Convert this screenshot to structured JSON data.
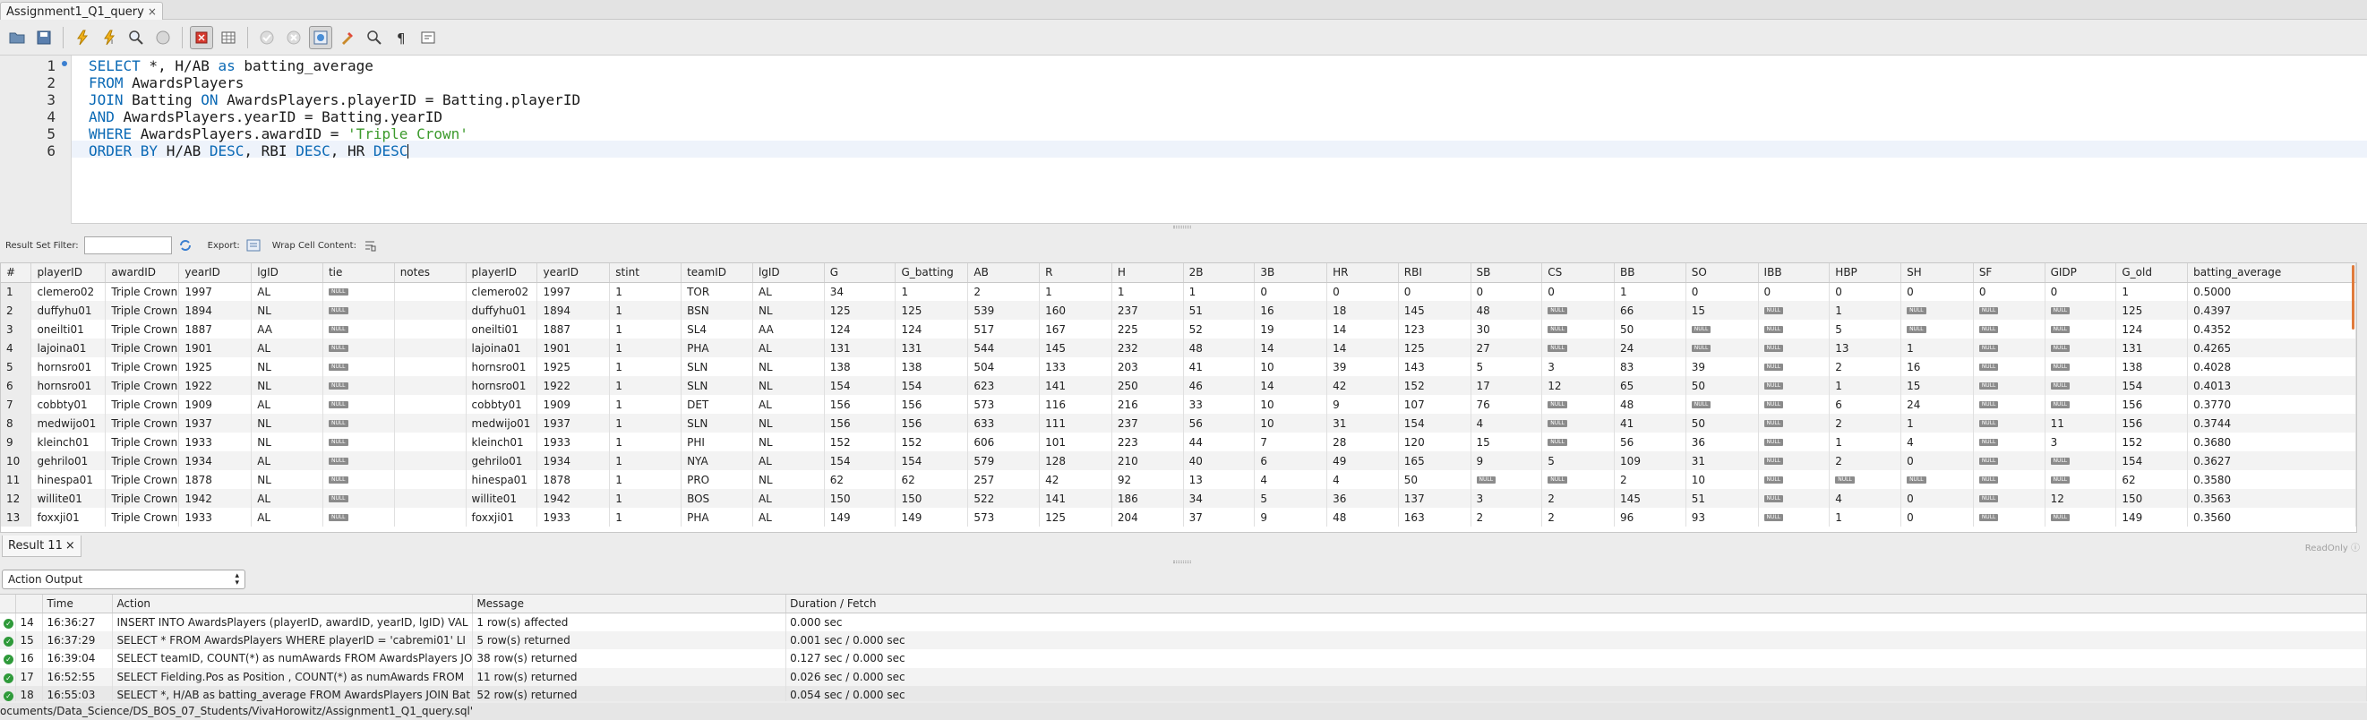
{
  "tab": {
    "title": "Assignment1_Q1_query",
    "close": "×"
  },
  "toolbar": {
    "icons": [
      "folder-open-icon",
      "save-icon",
      "execute-icon",
      "execute-current-icon",
      "explain-icon",
      "stop-icon",
      "stop-on-error-icon",
      "result-toggle-icon",
      "commit-icon",
      "rollback-icon",
      "autocommit-icon",
      "beautify-icon",
      "find-icon",
      "invisible-chars-icon",
      "wrap-icon"
    ]
  },
  "editor": {
    "lines": [
      {
        "num": "1"
      },
      {
        "num": "2"
      },
      {
        "num": "3"
      },
      {
        "num": "4"
      },
      {
        "num": "5"
      },
      {
        "num": "6"
      }
    ],
    "line1": {
      "kw1": "SELECT",
      "t1": " *, H/AB ",
      "kw2": "as",
      "t2": " batting_average"
    },
    "line2": {
      "kw1": "FROM",
      "t1": " AwardsPlayers"
    },
    "line3": {
      "kw1": "JOIN",
      "t1": " Batting ",
      "kw2": "ON",
      "t2": " AwardsPlayers.playerID = Batting.playerID"
    },
    "line4": {
      "kw1": "AND",
      "t1": " AwardsPlayers.yearID = Batting.yearID"
    },
    "line5": {
      "kw1": "WHERE",
      "t1": " AwardsPlayers.awardID = ",
      "str": "'Triple Crown'"
    },
    "line6": {
      "kw1": "ORDER BY",
      "t1": " H/AB ",
      "kw2": "DESC",
      "t2": ", RBI ",
      "kw3": "DESC",
      "t3": ", HR ",
      "kw4": "DESC"
    }
  },
  "filter": {
    "label": "Result Set Filter:",
    "export_label": "Export:",
    "wrap_label": "Wrap Cell Content:"
  },
  "grid": {
    "columns": [
      "#",
      "playerID",
      "awardID",
      "yearID",
      "lgID",
      "tie",
      "notes",
      "playerID",
      "yearID",
      "stint",
      "teamID",
      "lgID",
      "G",
      "G_batting",
      "AB",
      "R",
      "H",
      "2B",
      "3B",
      "HR",
      "RBI",
      "SB",
      "CS",
      "BB",
      "SO",
      "IBB",
      "HBP",
      "SH",
      "SF",
      "GIDP",
      "G_old",
      "batting_average"
    ],
    "null_label": "NULL",
    "rows": [
      [
        "1",
        "clemero02",
        "Triple Crown",
        "1997",
        "AL",
        "NULL",
        "",
        "clemero02",
        "1997",
        "1",
        "TOR",
        "AL",
        "34",
        "1",
        "2",
        "1",
        "1",
        "1",
        "0",
        "0",
        "0",
        "0",
        "0",
        "1",
        "0",
        "0",
        "0",
        "0",
        "0",
        "0",
        "1",
        "0.5000"
      ],
      [
        "2",
        "duffyhu01",
        "Triple Crown",
        "1894",
        "NL",
        "NULL",
        "",
        "duffyhu01",
        "1894",
        "1",
        "BSN",
        "NL",
        "125",
        "125",
        "539",
        "160",
        "237",
        "51",
        "16",
        "18",
        "145",
        "48",
        "NULL",
        "66",
        "15",
        "NULL",
        "1",
        "NULL",
        "NULL",
        "NULL",
        "125",
        "0.4397"
      ],
      [
        "3",
        "oneilti01",
        "Triple Crown",
        "1887",
        "AA",
        "NULL",
        "",
        "oneilti01",
        "1887",
        "1",
        "SL4",
        "AA",
        "124",
        "124",
        "517",
        "167",
        "225",
        "52",
        "19",
        "14",
        "123",
        "30",
        "NULL",
        "50",
        "NULL",
        "NULL",
        "5",
        "NULL",
        "NULL",
        "NULL",
        "124",
        "0.4352"
      ],
      [
        "4",
        "lajoina01",
        "Triple Crown",
        "1901",
        "AL",
        "NULL",
        "",
        "lajoina01",
        "1901",
        "1",
        "PHA",
        "AL",
        "131",
        "131",
        "544",
        "145",
        "232",
        "48",
        "14",
        "14",
        "125",
        "27",
        "NULL",
        "24",
        "NULL",
        "NULL",
        "13",
        "1",
        "NULL",
        "NULL",
        "131",
        "0.4265"
      ],
      [
        "5",
        "hornsro01",
        "Triple Crown",
        "1925",
        "NL",
        "NULL",
        "",
        "hornsro01",
        "1925",
        "1",
        "SLN",
        "NL",
        "138",
        "138",
        "504",
        "133",
        "203",
        "41",
        "10",
        "39",
        "143",
        "5",
        "3",
        "83",
        "39",
        "NULL",
        "2",
        "16",
        "NULL",
        "NULL",
        "138",
        "0.4028"
      ],
      [
        "6",
        "hornsro01",
        "Triple Crown",
        "1922",
        "NL",
        "NULL",
        "",
        "hornsro01",
        "1922",
        "1",
        "SLN",
        "NL",
        "154",
        "154",
        "623",
        "141",
        "250",
        "46",
        "14",
        "42",
        "152",
        "17",
        "12",
        "65",
        "50",
        "NULL",
        "1",
        "15",
        "NULL",
        "NULL",
        "154",
        "0.4013"
      ],
      [
        "7",
        "cobbty01",
        "Triple Crown",
        "1909",
        "AL",
        "NULL",
        "",
        "cobbty01",
        "1909",
        "1",
        "DET",
        "AL",
        "156",
        "156",
        "573",
        "116",
        "216",
        "33",
        "10",
        "9",
        "107",
        "76",
        "NULL",
        "48",
        "NULL",
        "NULL",
        "6",
        "24",
        "NULL",
        "NULL",
        "156",
        "0.3770"
      ],
      [
        "8",
        "medwijo01",
        "Triple Crown",
        "1937",
        "NL",
        "NULL",
        "",
        "medwijo01",
        "1937",
        "1",
        "SLN",
        "NL",
        "156",
        "156",
        "633",
        "111",
        "237",
        "56",
        "10",
        "31",
        "154",
        "4",
        "NULL",
        "41",
        "50",
        "NULL",
        "2",
        "1",
        "NULL",
        "11",
        "156",
        "0.3744"
      ],
      [
        "9",
        "kleinch01",
        "Triple Crown",
        "1933",
        "NL",
        "NULL",
        "",
        "kleinch01",
        "1933",
        "1",
        "PHI",
        "NL",
        "152",
        "152",
        "606",
        "101",
        "223",
        "44",
        "7",
        "28",
        "120",
        "15",
        "NULL",
        "56",
        "36",
        "NULL",
        "1",
        "4",
        "NULL",
        "3",
        "152",
        "0.3680"
      ],
      [
        "10",
        "gehrilo01",
        "Triple Crown",
        "1934",
        "AL",
        "NULL",
        "",
        "gehrilo01",
        "1934",
        "1",
        "NYA",
        "AL",
        "154",
        "154",
        "579",
        "128",
        "210",
        "40",
        "6",
        "49",
        "165",
        "9",
        "5",
        "109",
        "31",
        "NULL",
        "2",
        "0",
        "NULL",
        "NULL",
        "154",
        "0.3627"
      ],
      [
        "11",
        "hinespa01",
        "Triple Crown",
        "1878",
        "NL",
        "NULL",
        "",
        "hinespa01",
        "1878",
        "1",
        "PRO",
        "NL",
        "62",
        "62",
        "257",
        "42",
        "92",
        "13",
        "4",
        "4",
        "50",
        "NULL",
        "NULL",
        "2",
        "10",
        "NULL",
        "NULL",
        "NULL",
        "NULL",
        "NULL",
        "62",
        "0.3580"
      ],
      [
        "12",
        "willite01",
        "Triple Crown",
        "1942",
        "AL",
        "NULL",
        "",
        "willite01",
        "1942",
        "1",
        "BOS",
        "AL",
        "150",
        "150",
        "522",
        "141",
        "186",
        "34",
        "5",
        "36",
        "137",
        "3",
        "2",
        "145",
        "51",
        "NULL",
        "4",
        "0",
        "NULL",
        "12",
        "150",
        "0.3563"
      ],
      [
        "13",
        "foxxji01",
        "Triple Crown",
        "1933",
        "AL",
        "NULL",
        "",
        "foxxji01",
        "1933",
        "1",
        "PHA",
        "AL",
        "149",
        "149",
        "573",
        "125",
        "204",
        "37",
        "9",
        "48",
        "163",
        "2",
        "2",
        "96",
        "93",
        "NULL",
        "1",
        "0",
        "NULL",
        "NULL",
        "149",
        "0.3560"
      ]
    ]
  },
  "result_tab": {
    "label": "Result 11",
    "close": "×"
  },
  "readonly": "ReadOnly",
  "output": {
    "selector": "Action Output",
    "columns": [
      "",
      "Time",
      "Action",
      "Message",
      "Duration / Fetch"
    ],
    "rows": [
      [
        "14",
        "16:36:27",
        "INSERT INTO AwardsPlayers (playerID, awardID, yearID, lgID) VAL",
        "1 row(s) affected",
        "0.000 sec"
      ],
      [
        "15",
        "16:37:29",
        "SELECT * FROM AwardsPlayers WHERE playerID = 'cabremi01' LI",
        "5 row(s) returned",
        "0.001 sec / 0.000 sec"
      ],
      [
        "16",
        "16:39:04",
        "SELECT teamID, COUNT(*) as numAwards FROM AwardsPlayers JO",
        "38 row(s) returned",
        "0.127 sec / 0.000 sec"
      ],
      [
        "17",
        "16:52:55",
        "SELECT  Fielding.Pos as Position , COUNT(*) as numAwards FROM",
        "11 row(s) returned",
        "0.026 sec / 0.000 sec"
      ],
      [
        "18",
        "16:55:03",
        "SELECT *, H/AB as batting_average FROM AwardsPlayers JOIN Bat",
        "52 row(s) returned",
        "0.054 sec / 0.000 sec"
      ]
    ]
  },
  "status": "ocuments/Data_Science/DS_BOS_07_Students/VivaHorowitz/Assignment1_Q1_query.sql'"
}
